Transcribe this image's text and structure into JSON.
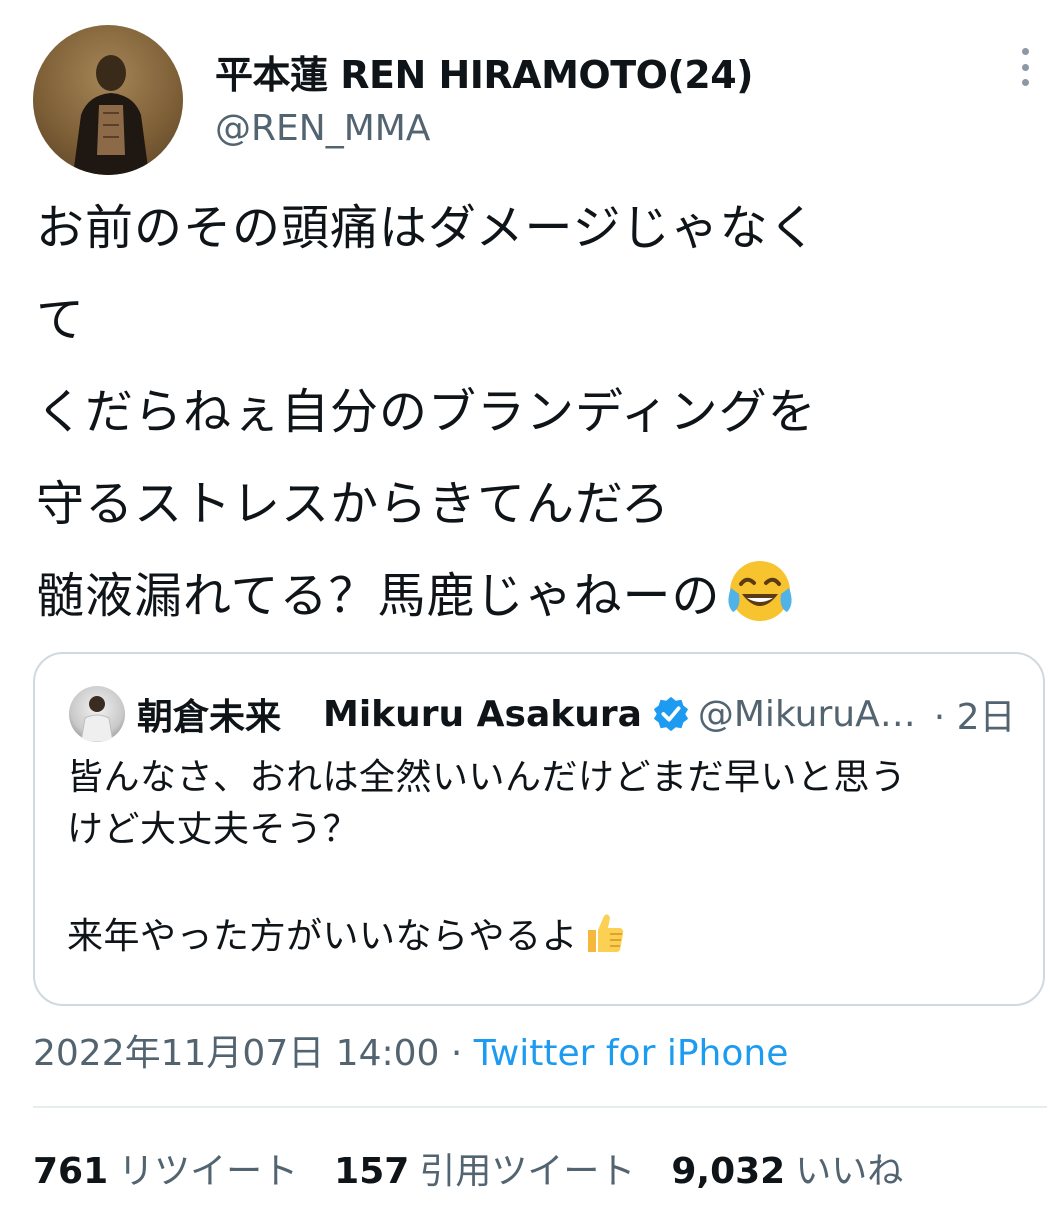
{
  "author": {
    "display_name": "平本蓮 REN HIRAMOTO(24)",
    "handle": "@REN_MMA"
  },
  "tweet": {
    "text": "お前のその頭痛はダメージじゃなく\nて\nくだらねぇ自分のブランディングを\n守るストレスからきてんだろ\n髄液漏れてる？馬鹿じゃねーの",
    "trailing_emoji": "face-with-tears-of-joy"
  },
  "quoted_tweet": {
    "display_name": "朝倉未来　Mikuru Asakura",
    "name_jp": "朝倉未来",
    "name_en": "Mikuru Asakura",
    "verified": true,
    "handle": "@MikuruA…",
    "date": "· 2日",
    "text": "皆んなさ、おれは全然いいんだけどまだ早いと思う\nけど大丈夫そう？\n\n来年やった方がいいならやるよ",
    "trailing_emoji": "thumbs-up"
  },
  "meta": {
    "timestamp": "2022年11月07日 14:00",
    "separator": " · ",
    "source": "Twitter for iPhone"
  },
  "stats": [
    {
      "count": "761",
      "label": "リツイート"
    },
    {
      "count": "157",
      "label": "引用ツイート"
    },
    {
      "count": "9,032",
      "label": "いいね"
    }
  ],
  "colors": {
    "link": "#1d9bf0",
    "secondary_text": "#536471",
    "primary_text": "#0f1419",
    "border": "#cfd9de"
  }
}
